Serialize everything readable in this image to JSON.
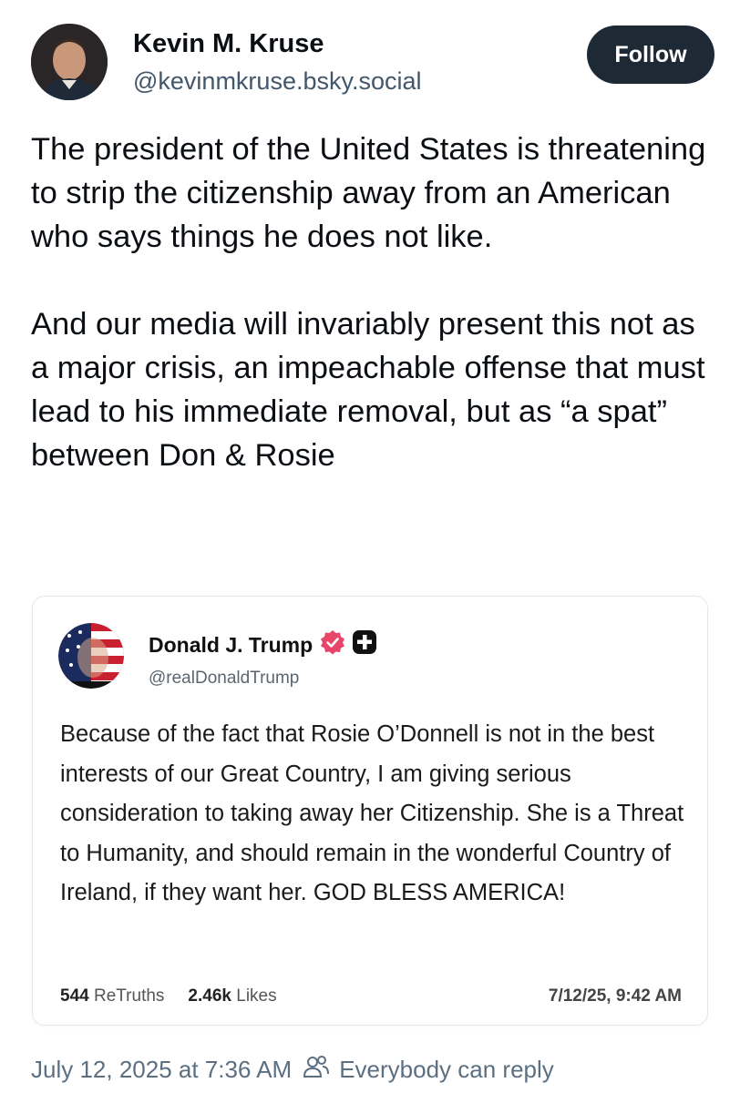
{
  "author": {
    "name": "Kevin M. Kruse",
    "handle": "@kevinmkruse.bsky.social",
    "follow_label": "Follow"
  },
  "post": {
    "paragraphs": [
      "The president of the United States is threatening to strip the citizenship away from an American who says things he does not like.",
      "And our media will invariably present this not as a major crisis, an impeachable offense that must lead to his immediate removal, but as “a spat” between Don & Rosie"
    ]
  },
  "quote": {
    "name": "Donald J. Trump",
    "handle": "@realDonaldTrump",
    "body": "Because of the fact that Rosie O’Donnell is not in the best interests of our Great Country, I am giving serious consideration to taking away her Citizenship. She is a Threat to Humanity, and should remain in the wonderful Country of Ireland, if they want her. GOD BLESS AMERICA!",
    "retruths_count": "544",
    "retruths_label": "ReTruths",
    "likes_count": "2.46k",
    "likes_label": "Likes",
    "timestamp": "7/12/25, 9:42 AM",
    "verified_color": "#e8456b"
  },
  "footer": {
    "timestamp": "July 12, 2025 at 7:36 AM",
    "reply_setting": "Everybody can reply"
  }
}
